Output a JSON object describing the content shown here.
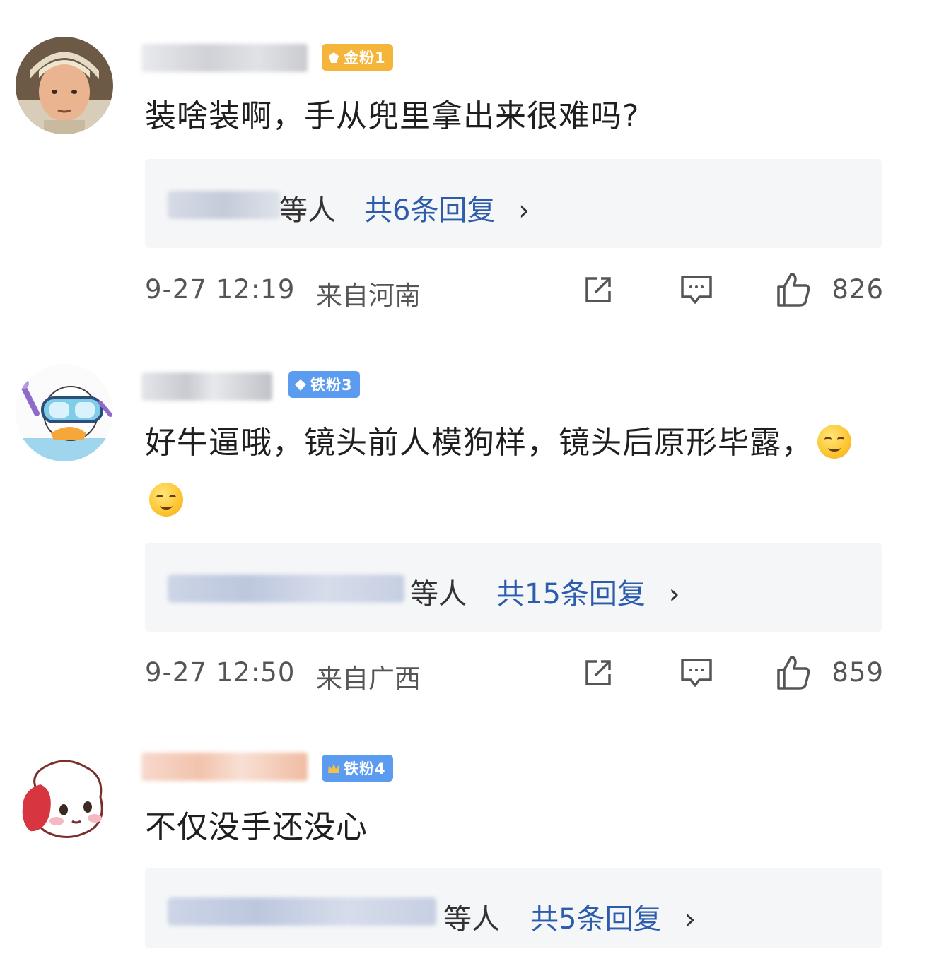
{
  "comments": [
    {
      "badge": "金粉1",
      "badge_color": "#f5b53a",
      "text": "装啥装啊，手从兜里拿出来很难吗?",
      "reply_etc": "等人",
      "reply_total": "共6条回复",
      "reply_chevron": "›",
      "time": "9-27 12:19",
      "location": "来自河南",
      "likes": "826"
    },
    {
      "badge": "铁粉3",
      "badge_color": "#5b9bf0",
      "text": "好牛逼哦，镜头前人模狗样，镜头后原形毕露，",
      "emoji_count": 2,
      "reply_etc": "等人",
      "reply_total": "共15条回复",
      "reply_chevron": "›",
      "time": "9-27 12:50",
      "location": "来自广西",
      "likes": "859"
    },
    {
      "badge": "铁粉4",
      "badge_color": "#5b9bf0",
      "text": "不仅没手还没心",
      "reply_etc": "等人",
      "reply_total": "共5条回复",
      "reply_chevron": "›"
    }
  ],
  "icons": {
    "share": "share-icon",
    "comment": "comment-icon",
    "like": "thumbs-up-icon"
  },
  "colors": {
    "link_blue": "#2c5cab",
    "reply_bg": "#f5f6f8",
    "meta_gray": "#555555"
  }
}
